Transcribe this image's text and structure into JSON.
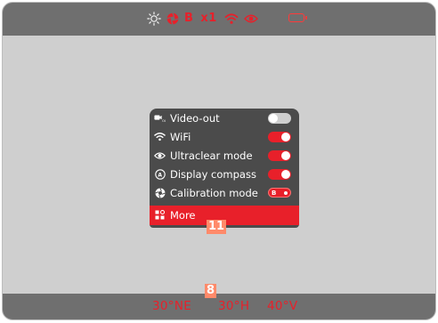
{
  "statusbar": {
    "mode": "B",
    "zoom": "x1",
    "icons": [
      "brightness-icon",
      "calibration-icon",
      "wifi-icon",
      "ultraclear-eye-icon",
      "battery-icon"
    ]
  },
  "menu": {
    "items": [
      {
        "label": "Video-out",
        "icon": "video-out-icon",
        "control": "toggle",
        "state": "off"
      },
      {
        "label": "WiFi",
        "icon": "wifi-icon",
        "control": "toggle",
        "state": "on"
      },
      {
        "label": "Ultraclear mode",
        "icon": "eye-icon",
        "control": "toggle",
        "state": "on"
      },
      {
        "label": "Display compass",
        "icon": "compass-icon",
        "control": "toggle",
        "state": "on"
      },
      {
        "label": "Calibration mode",
        "icon": "calibration-icon",
        "control": "select",
        "value": "B"
      },
      {
        "label": "More",
        "icon": "more-icon",
        "selected": true
      }
    ]
  },
  "callouts": {
    "menu": "11",
    "compass": "8"
  },
  "compass": {
    "bearing": "30°NE",
    "horizontal": "30°H",
    "vertical": "40°V"
  },
  "colors": {
    "accent": "#e8202a",
    "bar": "#6f6f6f",
    "menu": "#4b4b4b",
    "viewfinder": "#cfcfcf",
    "callout": "#ff8a6a"
  }
}
